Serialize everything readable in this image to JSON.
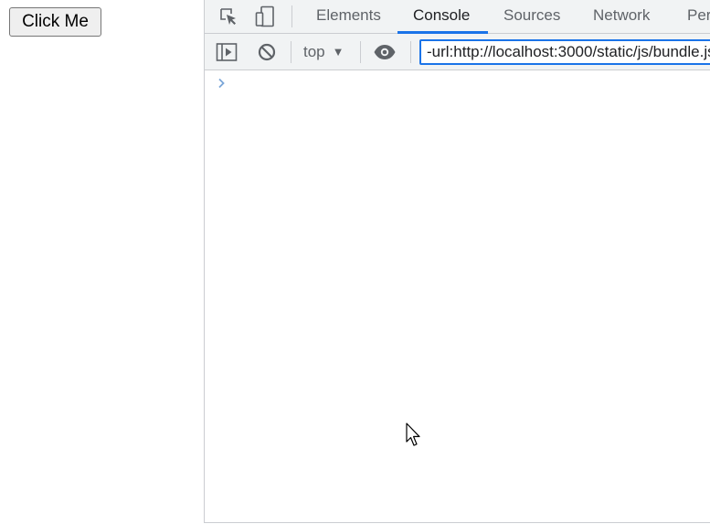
{
  "page": {
    "button_label": "Click Me"
  },
  "devtools": {
    "toolbar_icons": [
      "inspect-element-icon",
      "device-toolbar-icon"
    ],
    "tabs": [
      {
        "label": "Elements",
        "active": false
      },
      {
        "label": "Console",
        "active": true
      },
      {
        "label": "Sources",
        "active": false
      },
      {
        "label": "Network",
        "active": false
      },
      {
        "label": "Per",
        "active": false
      }
    ],
    "console_toolbar": {
      "sidebar_icon": "show-sidebar-icon",
      "clear_icon": "clear-console-icon",
      "context": "top",
      "live_expression_icon": "eye-icon",
      "filter_value": "-url:http://localhost:3000/static/js/bundle.js"
    },
    "prompt_icon": "chevron-right-icon"
  },
  "colors": {
    "accent": "#1a73e8",
    "toolbar_bg": "#f1f3f4",
    "border": "#cbcdd1",
    "icon": "#5f6368"
  }
}
